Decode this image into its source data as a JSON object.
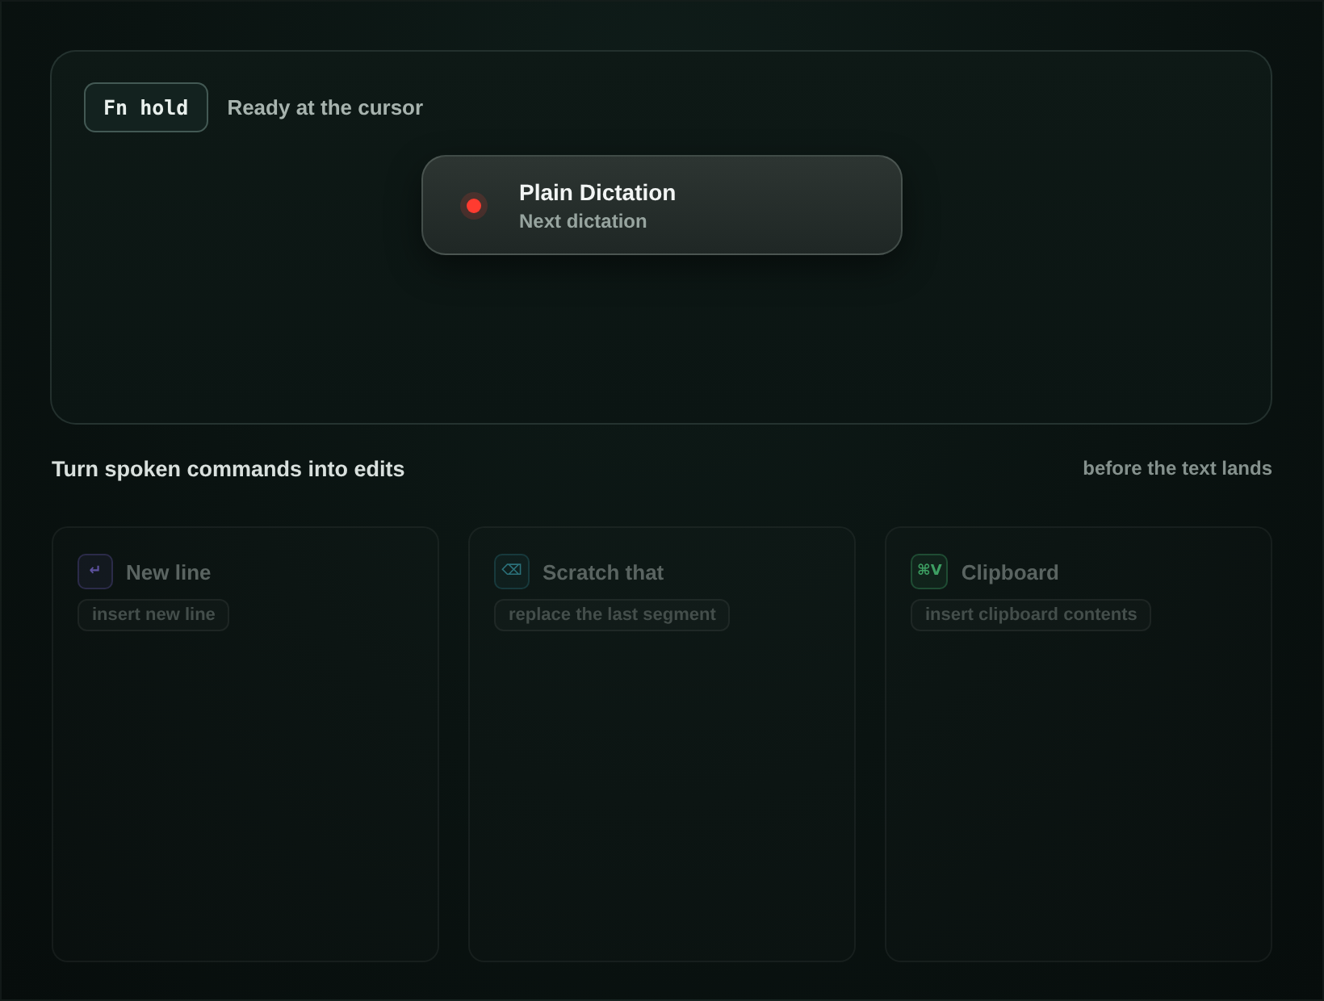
{
  "hotkey": {
    "label": "Fn hold",
    "status": "Ready at the cursor"
  },
  "indicator": {
    "recording": true,
    "title": "Plain Dictation",
    "subtitle": "Next dictation"
  },
  "commands_section": {
    "title": "Turn spoken commands into edits",
    "note": "before the text lands"
  },
  "commands": [
    {
      "glyph": "↵",
      "color": "#5e52a0",
      "title": "New line",
      "action": "insert new line"
    },
    {
      "glyph": "⌫",
      "color": "#2b7079",
      "title": "Scratch that",
      "action": "replace the last segment"
    },
    {
      "glyph": "⌘V",
      "color": "#3d9e62",
      "title": "Clipboard",
      "action": "insert clipboard contents"
    }
  ]
}
